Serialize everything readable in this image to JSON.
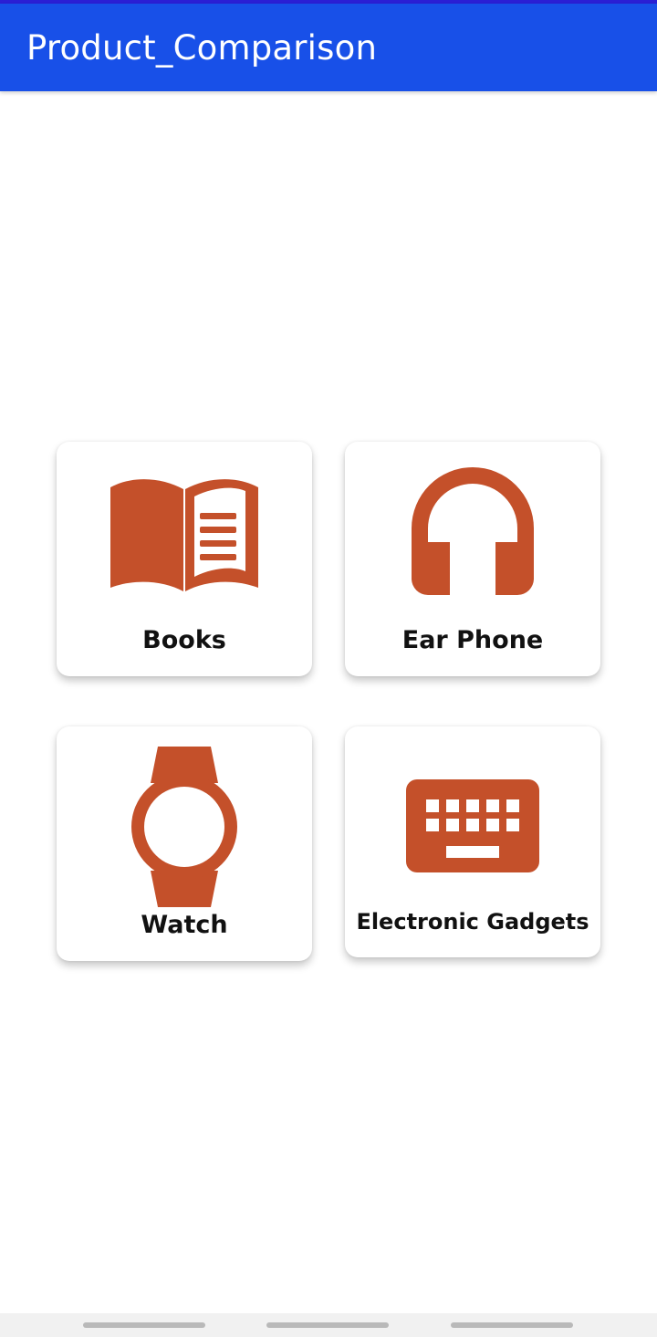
{
  "app_bar": {
    "title": "Product_Comparison",
    "color": "#1850e8"
  },
  "accent_color": "#c4502a",
  "categories": [
    {
      "label": "Books",
      "icon": "book-open-icon"
    },
    {
      "label": "Ear Phone",
      "icon": "headphones-icon"
    },
    {
      "label": "Watch",
      "icon": "watch-icon"
    },
    {
      "label": "Electronic Gadgets",
      "icon": "keyboard-icon"
    }
  ],
  "nav_bar": {
    "buttons": [
      "recent-apps-nav",
      "home-nav",
      "back-nav"
    ]
  }
}
